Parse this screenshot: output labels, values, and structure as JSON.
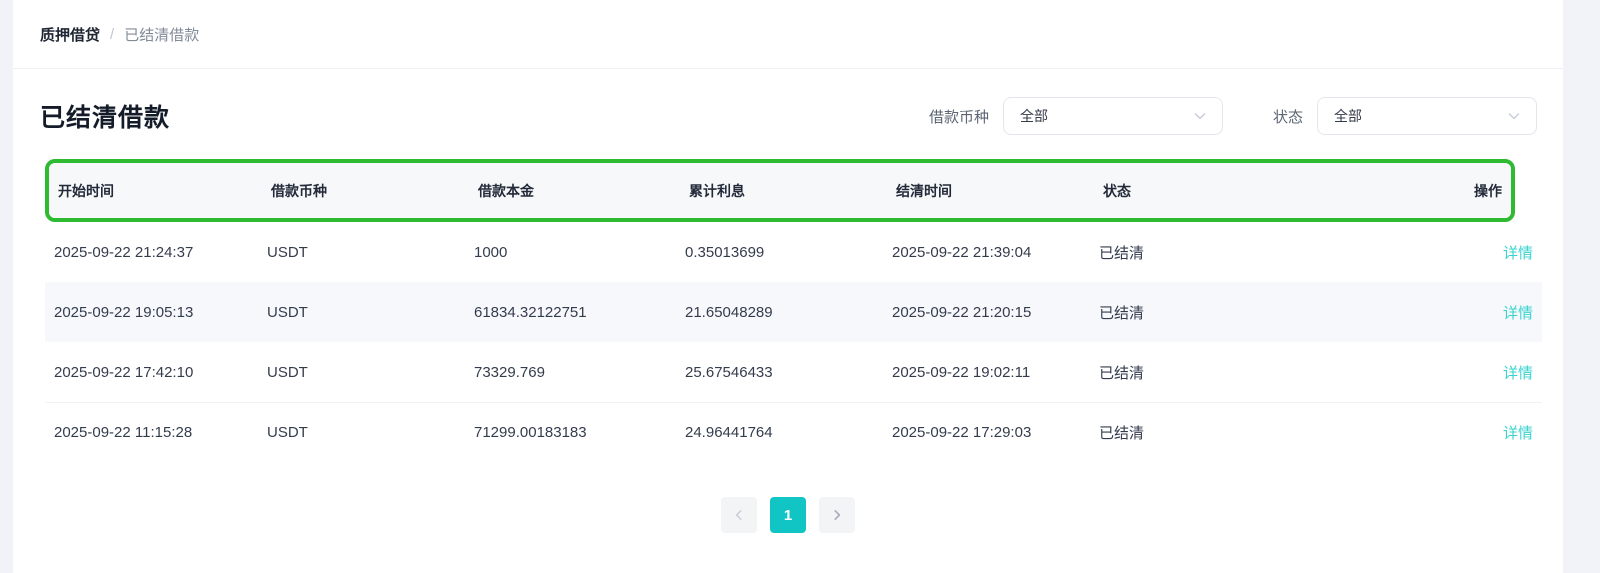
{
  "breadcrumb": {
    "parent": "质押借贷",
    "separator": "/",
    "current": "已结清借款"
  },
  "page": {
    "title": "已结清借款"
  },
  "filters": {
    "currency": {
      "label": "借款币种",
      "value": "全部"
    },
    "status": {
      "label": "状态",
      "value": "全部"
    }
  },
  "table": {
    "columns": [
      "开始时间",
      "借款币种",
      "借款本金",
      "累计利息",
      "结清时间",
      "状态",
      "操作"
    ],
    "rows": [
      {
        "start_time": "2025-09-22 21:24:37",
        "currency": "USDT",
        "principal": "1000",
        "interest": "0.35013699",
        "settle_time": "2025-09-22 21:39:04",
        "status": "已结清",
        "action": "详情"
      },
      {
        "start_time": "2025-09-22 19:05:13",
        "currency": "USDT",
        "principal": "61834.32122751",
        "interest": "21.65048289",
        "settle_time": "2025-09-22 21:20:15",
        "status": "已结清",
        "action": "详情"
      },
      {
        "start_time": "2025-09-22 17:42:10",
        "currency": "USDT",
        "principal": "73329.769",
        "interest": "25.67546433",
        "settle_time": "2025-09-22 19:02:11",
        "status": "已结清",
        "action": "详情"
      },
      {
        "start_time": "2025-09-22 11:15:28",
        "currency": "USDT",
        "principal": "71299.00183183",
        "interest": "24.96441764",
        "settle_time": "2025-09-22 17:29:03",
        "status": "已结清",
        "action": "详情"
      }
    ]
  },
  "pagination": {
    "current_page": "1"
  },
  "icons": {
    "filter_dropdown": "chevron-down-icon",
    "pagination_prev": "chevron-left-icon",
    "pagination_next": "chevron-right-icon"
  },
  "colors": {
    "accent_teal": "#12c5c5",
    "link_teal": "#38d3cf",
    "annotation_green": "#2fbb31",
    "header_bg": "#f7f8fa",
    "alt_row_bg": "#f7f8fb",
    "page_bg": "#f1f3f8"
  }
}
